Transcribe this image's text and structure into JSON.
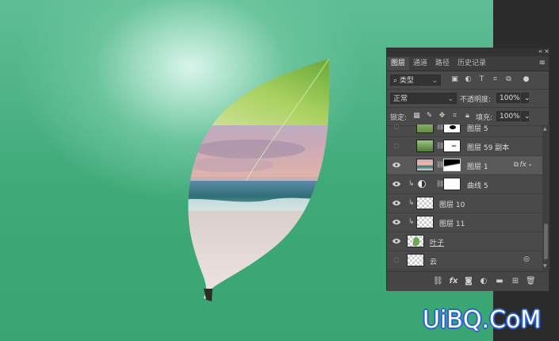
{
  "panel": {
    "tabs": [
      "图层",
      "通道",
      "路径",
      "历史记录"
    ],
    "filter_kind": "类型",
    "blend_mode": "正常",
    "opacity_label": "不透明度:",
    "opacity_value": "100%",
    "lock_label": "锁定:",
    "fill_label": "填充:",
    "fill_value": "100%",
    "layers": [
      {
        "name": "图层 5",
        "visible": false,
        "selected": false
      },
      {
        "name": "图层 59 副本",
        "visible": false,
        "selected": false
      },
      {
        "name": "图层 1",
        "visible": true,
        "selected": true,
        "fx": "fx"
      },
      {
        "name": "曲线 5",
        "visible": true,
        "selected": false
      },
      {
        "name": "图层 10",
        "visible": true,
        "selected": false
      },
      {
        "name": "图层 11",
        "visible": true,
        "selected": false
      },
      {
        "name": "叶子",
        "visible": true,
        "selected": false
      },
      {
        "name": "云",
        "visible": false,
        "selected": false
      }
    ],
    "bottom_icons": [
      "link-icon",
      "fx-icon",
      "mask-icon",
      "adjustment-icon",
      "group-folder-icon",
      "new-layer-icon",
      "trash-icon"
    ],
    "fx_label": "fx"
  },
  "watermark": "UiBQ.CoM",
  "colors": {
    "background_green": "#3faa78",
    "panel_bg": "#4a4a4a",
    "selected_row": "#595959",
    "watermark_outline": "#2a5fd6"
  }
}
